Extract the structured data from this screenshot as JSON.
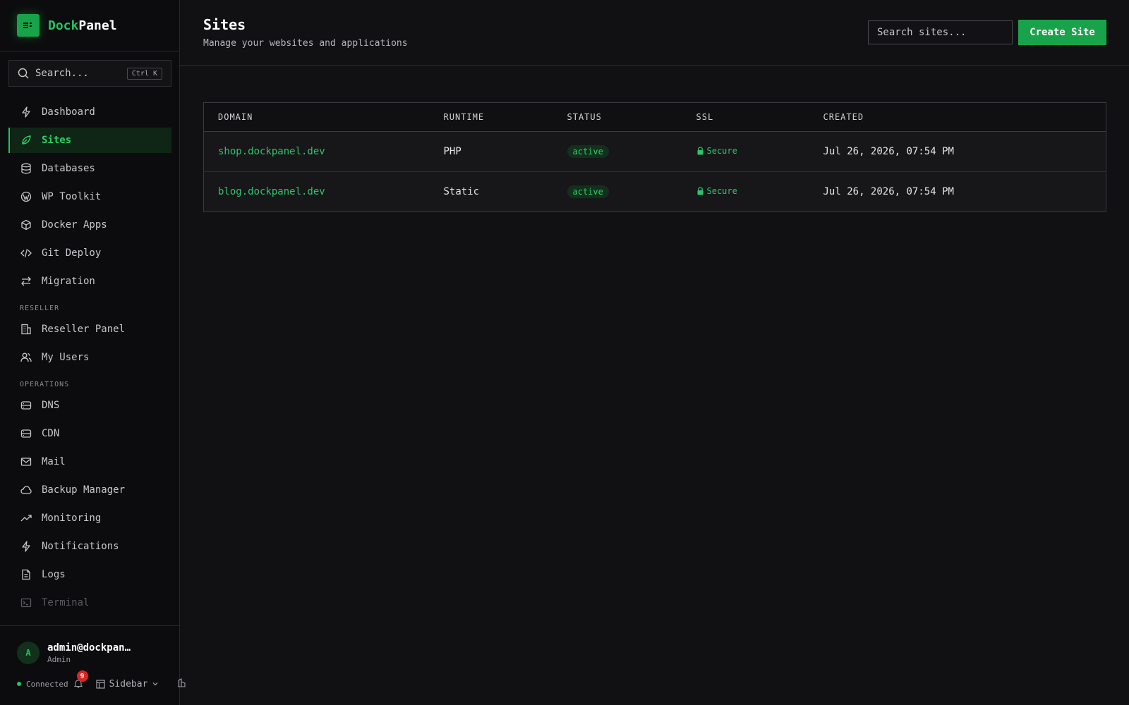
{
  "brand": {
    "part1": "Dock",
    "part2": "Panel"
  },
  "sidebar_search": {
    "placeholder": "Search...",
    "shortcut": "Ctrl K"
  },
  "nav": {
    "main": [
      {
        "label": "Dashboard",
        "icon": "bolt-icon"
      },
      {
        "label": "Sites",
        "icon": "leaf-icon",
        "active": true
      },
      {
        "label": "Databases",
        "icon": "database-icon"
      },
      {
        "label": "WP Toolkit",
        "icon": "wordpress-icon"
      },
      {
        "label": "Docker Apps",
        "icon": "cube-icon"
      },
      {
        "label": "Git Deploy",
        "icon": "code-icon"
      },
      {
        "label": "Migration",
        "icon": "arrows-icon"
      }
    ],
    "reseller_label": "RESELLER",
    "reseller": [
      {
        "label": "Reseller Panel",
        "icon": "building-icon"
      },
      {
        "label": "My Users",
        "icon": "users-icon"
      }
    ],
    "operations_label": "OPERATIONS",
    "operations": [
      {
        "label": "DNS",
        "icon": "server-icon"
      },
      {
        "label": "CDN",
        "icon": "server-icon"
      },
      {
        "label": "Mail",
        "icon": "mail-icon"
      },
      {
        "label": "Backup Manager",
        "icon": "cloud-icon"
      },
      {
        "label": "Monitoring",
        "icon": "trend-icon"
      },
      {
        "label": "Notifications",
        "icon": "bolt-icon"
      },
      {
        "label": "Logs",
        "icon": "file-icon"
      },
      {
        "label": "Terminal",
        "icon": "terminal-icon"
      }
    ]
  },
  "user": {
    "initial": "A",
    "email": "admin@dockpanel.dev",
    "role": "Admin"
  },
  "footer": {
    "status": "Connected",
    "notif_count": "9",
    "layout_label": "Sidebar"
  },
  "header": {
    "title": "Sites",
    "subtitle": "Manage your websites and applications",
    "search_placeholder": "Search sites...",
    "create_label": "Create Site"
  },
  "table": {
    "columns": [
      "DOMAIN",
      "RUNTIME",
      "STATUS",
      "SSL",
      "CREATED"
    ],
    "rows": [
      {
        "domain": "shop.dockpanel.dev",
        "runtime": "PHP",
        "status": "active",
        "ssl": "Secure",
        "created": "Jul 26, 2026, 07:54 PM"
      },
      {
        "domain": "blog.dockpanel.dev",
        "runtime": "Static",
        "status": "active",
        "ssl": "Secure",
        "created": "Jul 26, 2026, 07:54 PM"
      }
    ]
  },
  "colors": {
    "accent": "#22c55e",
    "button": "#18a34a",
    "badge": "#dc2626"
  }
}
